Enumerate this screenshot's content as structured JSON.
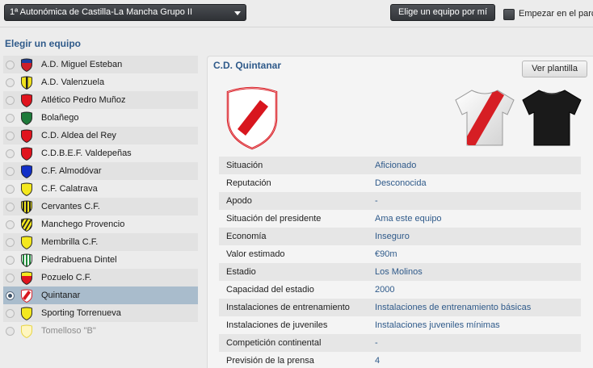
{
  "topbar": {
    "division_selected": "1ª Autonómica de Castilla-La Mancha Grupo II",
    "pick_team_label": "Elige un equipo por mí",
    "start_label": "Empezar en el parc"
  },
  "left": {
    "title": "Elegir un equipo",
    "teams": [
      {
        "name": "A.D. Miguel Esteban",
        "crest_color": "#cc1f2b",
        "crest_accent": "#1b3fa0",
        "crest_pattern": "top-band"
      },
      {
        "name": "A.D. Valenzuela",
        "crest_color": "#f0e11c",
        "crest_accent": "#222222",
        "crest_pattern": "stripe"
      },
      {
        "name": "Atlético Pedro Muñoz",
        "crest_color": "#e0141e",
        "crest_accent": "#e0141e",
        "crest_pattern": "plain"
      },
      {
        "name": "Bolañego",
        "crest_color": "#1e7a3a",
        "crest_accent": "#1e7a3a",
        "crest_pattern": "plain"
      },
      {
        "name": "C.D. Aldea del Rey",
        "crest_color": "#e0141e",
        "crest_accent": "#e0141e",
        "crest_pattern": "plain"
      },
      {
        "name": "C.D.B.E.F. Valdepeñas",
        "crest_color": "#e0141e",
        "crest_accent": "#e0141e",
        "crest_pattern": "plain"
      },
      {
        "name": "C.F. Almodóvar",
        "crest_color": "#1230c8",
        "crest_accent": "#1230c8",
        "crest_pattern": "plain"
      },
      {
        "name": "C.F. Calatrava",
        "crest_color": "#f4e81e",
        "crest_accent": "#f4e81e",
        "crest_pattern": "plain"
      },
      {
        "name": "Cervantes C.F.",
        "crest_color": "#f4e81e",
        "crest_accent": "#222222",
        "crest_pattern": "stripes"
      },
      {
        "name": "Manchego Provencio",
        "crest_color": "#f4e81e",
        "crest_accent": "#222222",
        "crest_pattern": "diagonal-stripes"
      },
      {
        "name": "Membrilla C.F.",
        "crest_color": "#f4e81e",
        "crest_accent": "#f4e81e",
        "crest_pattern": "plain"
      },
      {
        "name": "Piedrabuena Dintel",
        "crest_color": "#ffffff",
        "crest_accent": "#1e8a3a",
        "crest_pattern": "stripes"
      },
      {
        "name": "Pozuelo C.F.",
        "crest_color": "#e0141e",
        "crest_accent": "#f4e81e",
        "crest_pattern": "top-band"
      },
      {
        "name": "Quintanar",
        "crest_color": "#ffffff",
        "crest_accent": "#d8161e",
        "crest_pattern": "sash",
        "selected": true
      },
      {
        "name": "Sporting Torrenueva",
        "crest_color": "#f4e81e",
        "crest_accent": "#f4e81e",
        "crest_pattern": "plain"
      },
      {
        "name": "Tomelloso \"B\"",
        "crest_color": "#fff6c0",
        "crest_accent": "#e6d23a",
        "crest_pattern": "outline",
        "disabled": true
      }
    ]
  },
  "detail": {
    "club_name": "C.D. Quintanar",
    "view_squad_label": "Ver plantilla",
    "kit_home_colors": {
      "shirt": "#f2f2f2",
      "sash": "#d61e24"
    },
    "kit_away_colors": {
      "shirt": "#1a1a1a"
    },
    "info": [
      {
        "label": "Situación",
        "value": "Aficionado"
      },
      {
        "label": "Reputación",
        "value": "Desconocida"
      },
      {
        "label": "Apodo",
        "value": "-"
      },
      {
        "label": "Situación del presidente",
        "value": "Ama este equipo"
      },
      {
        "label": "Economía",
        "value": "Inseguro"
      },
      {
        "label": "Valor estimado",
        "value": "€90m"
      },
      {
        "label": "Estadio",
        "value": "Los Molinos"
      },
      {
        "label": "Capacidad del estadio",
        "value": "2000"
      },
      {
        "label": "Instalaciones de entrenamiento",
        "value": "Instalaciones de entrenamiento básicas"
      },
      {
        "label": "Instalaciones de juveniles",
        "value": "Instalaciones juveniles mínimas"
      },
      {
        "label": "Competición continental",
        "value": "-"
      },
      {
        "label": "Previsión de la prensa",
        "value": "4"
      }
    ]
  }
}
